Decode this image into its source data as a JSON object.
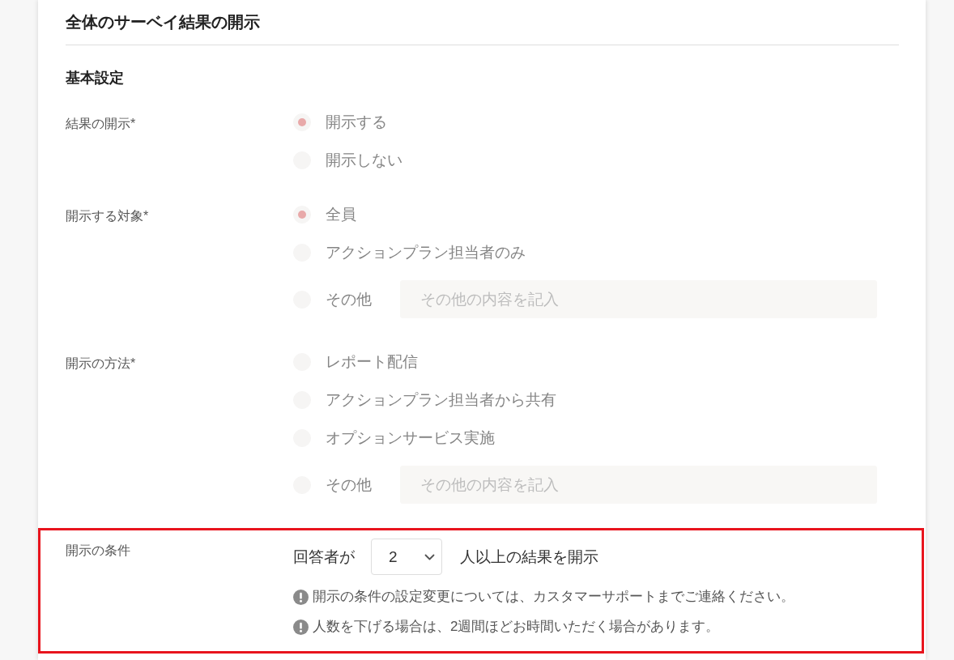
{
  "section": {
    "title": "全体のサーベイ結果の開示"
  },
  "group": {
    "title": "基本設定"
  },
  "fields": [
    {
      "label": "結果の開示*",
      "disabled": true,
      "options": [
        {
          "label": "開示する",
          "selected": true
        },
        {
          "label": "開示しない",
          "selected": false
        }
      ]
    },
    {
      "label": "開示する対象*",
      "disabled": true,
      "options": [
        {
          "label": "全員",
          "selected": true
        },
        {
          "label": "アクションプラン担当者のみ",
          "selected": false
        },
        {
          "label": "その他",
          "selected": false,
          "input": {
            "placeholder": "その他の内容を記入"
          }
        }
      ]
    },
    {
      "label": "開示の方法*",
      "disabled": true,
      "options": [
        {
          "label": "レポート配信",
          "selected": false
        },
        {
          "label": "アクションプラン担当者から共有",
          "selected": false
        },
        {
          "label": "オプションサービス実施",
          "selected": false
        },
        {
          "label": "その他",
          "selected": false,
          "input": {
            "placeholder": "その他の内容を記入"
          }
        }
      ]
    }
  ],
  "condition": {
    "label": "開示の条件",
    "highlighted": true,
    "prefix": "回答者が",
    "select": {
      "value": "2"
    },
    "suffix": "人以上の結果を開示",
    "notes": [
      "開示の条件の設定変更については、カスタマーサポートまでご連絡ください。",
      "人数を下げる場合は、2週間ほどお時間いただく場合があります。"
    ]
  }
}
